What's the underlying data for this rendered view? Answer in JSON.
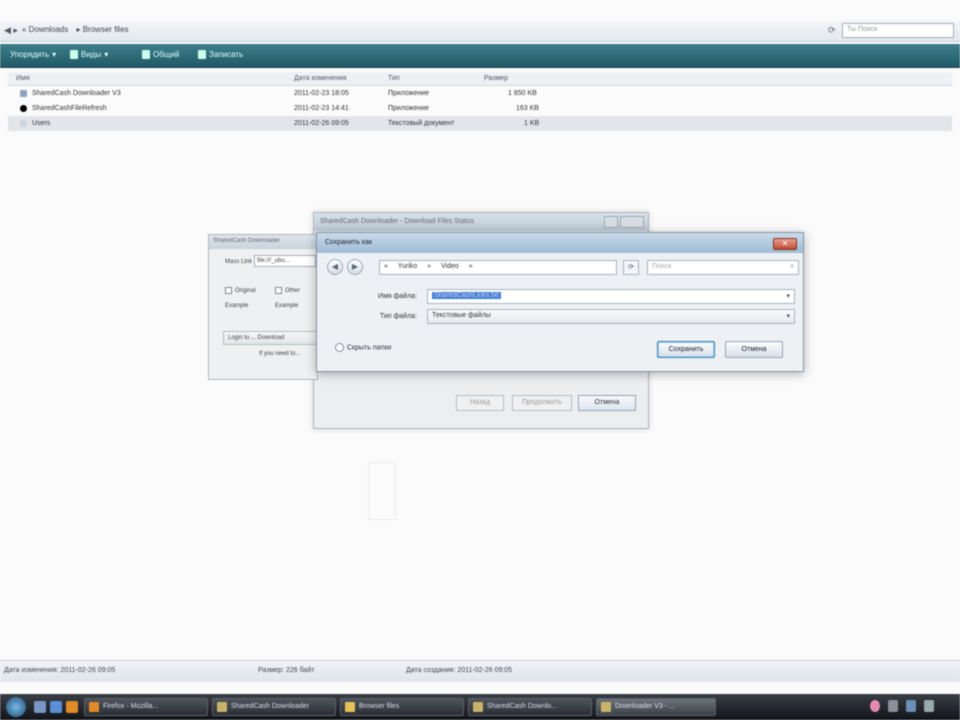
{
  "explorer": {
    "address": {
      "crumbs": [
        "« Downloads",
        "▸ Browser files"
      ],
      "search_placeholder": "Ты Поиск"
    },
    "toolbar": {
      "organize": "Упорядить",
      "views": "Виды",
      "share": "Общий",
      "burn": "Записать"
    },
    "columns": {
      "name": "Имя",
      "date": "Дата изменения",
      "type": "Тип",
      "size": "Размер"
    },
    "files": [
      {
        "name": "SharedCash Downloader V3",
        "date": "2011-02-23 18:05",
        "type": "Приложение",
        "size": "1 850 KB"
      },
      {
        "name": "SharedCashFileRefresh",
        "date": "2011-02-23 14:41",
        "type": "Приложение",
        "size": "163 KB"
      },
      {
        "name": "Users",
        "date": "2011-02-26 09:05",
        "type": "Текстовый документ",
        "size": "1 KB"
      }
    ],
    "status": {
      "item1": "Дата изменения: 2011-02-26 09:05",
      "item2": "Размер: 226 байт",
      "item3": "Дата создания: 2011-02-26 09:05"
    }
  },
  "back_dialog": {
    "title": "SharedCash Downloader - Download Files Status",
    "buttons": {
      "back": "Назад",
      "next": "Продолжить",
      "cancel": "Отмена"
    }
  },
  "left_dialog": {
    "title": "SharedCash Downloader",
    "mass_label": "Mass Link",
    "mass_value": "file:///_ubu...",
    "original": "Original",
    "other": "Other",
    "example_label": "Example",
    "example_value": "Example",
    "login_button": "Login to ... Download",
    "note": "If you need to..."
  },
  "save_dialog": {
    "title": "Сохранить как",
    "path": [
      "Yuriko",
      "»",
      "Video",
      "»"
    ],
    "search_placeholder": "Поиск",
    "filename_label": "Имя файла:",
    "filename_value": "SharedCashLinks.txt",
    "type_label": "Тип файла:",
    "type_value": "Текстовые файлы",
    "hide_folders": "Скрыть папки",
    "save": "Сохранить",
    "cancel": "Отмена"
  },
  "taskbar": {
    "buttons": [
      "Firefox - Mozilla...",
      "SharedCash Downloader",
      "Browser files",
      "SharedCash Downlo...",
      "Downloader V3 - ..."
    ]
  },
  "colors": {
    "accent": "#1f5a66",
    "selection": "#3d7fd4",
    "close": "#c34a33"
  }
}
